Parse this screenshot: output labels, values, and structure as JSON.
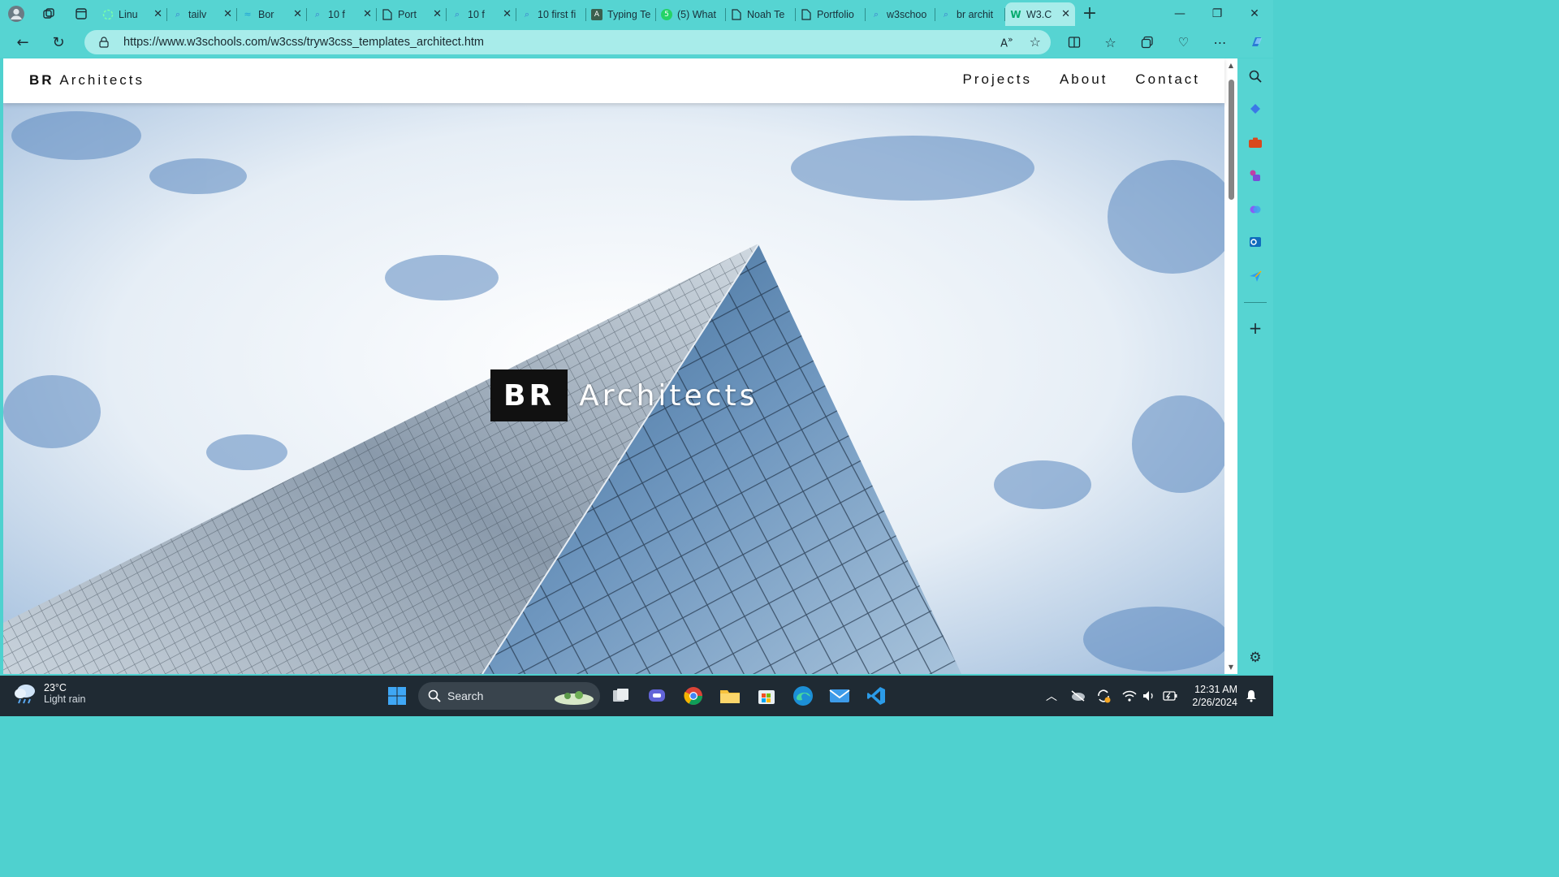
{
  "browser": {
    "tabs": [
      {
        "title": "Linu",
        "icon": "spinner-icon"
      },
      {
        "title": "tailv",
        "icon": "search-icon"
      },
      {
        "title": "Bor",
        "icon": "tailwind-icon"
      },
      {
        "title": "10 f",
        "icon": "search-icon"
      },
      {
        "title": "Port",
        "icon": "page-icon"
      },
      {
        "title": "10 f",
        "icon": "search-icon"
      },
      {
        "title": "10 first fi",
        "icon": "search-icon"
      },
      {
        "title": "Typing Te",
        "icon": "typing-icon"
      },
      {
        "title": "(5) What",
        "icon": "whatsapp-icon"
      },
      {
        "title": "Noah Te",
        "icon": "page-icon"
      },
      {
        "title": "Portfolio",
        "icon": "page-icon"
      },
      {
        "title": "w3schoo",
        "icon": "search-icon"
      },
      {
        "title": "br archit",
        "icon": "search-icon"
      },
      {
        "title": "W3.C",
        "icon": "w3schools-icon",
        "active": true
      }
    ],
    "url": "https://www.w3schools.com/w3css/tryw3css_templates_architect.htm"
  },
  "site": {
    "brand_bold": "BR",
    "brand_rest": "Architects",
    "nav": [
      "Projects",
      "About",
      "Contact"
    ],
    "hero_box": "BR",
    "hero_text": "Architects"
  },
  "taskbar": {
    "temperature": "23°C",
    "weather": "Light rain",
    "search_placeholder": "Search",
    "time": "12:31 AM",
    "date": "2/26/2024"
  },
  "colors": {
    "browser_chrome": "#56d4d2",
    "active_tab": "#a8ecea",
    "taskbar": "#1f2a33"
  }
}
